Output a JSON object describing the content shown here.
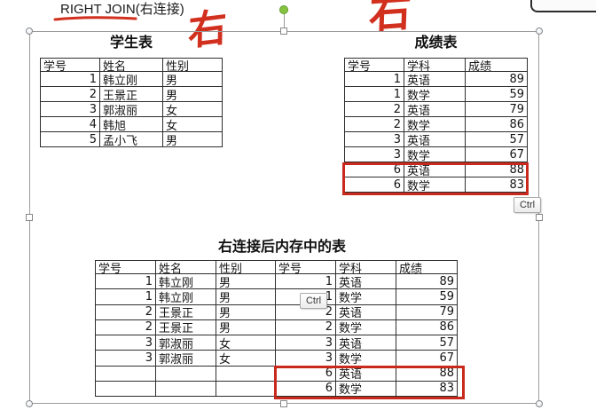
{
  "slide": {
    "heading": "RIGHT JOIN(右连接)"
  },
  "ink_annotations": [
    {
      "text": "右"
    },
    {
      "text": "右"
    }
  ],
  "student_table": {
    "title": "学生表",
    "columns": [
      "学号",
      "姓名",
      "性别"
    ],
    "rows": [
      [
        "1",
        "韩立刚",
        "男"
      ],
      [
        "2",
        "王景正",
        "男"
      ],
      [
        "3",
        "郭淑丽",
        "女"
      ],
      [
        "4",
        "韩旭",
        "女"
      ],
      [
        "5",
        "孟小飞",
        "男"
      ]
    ]
  },
  "score_table": {
    "title": "成绩表",
    "columns": [
      "学号",
      "学科",
      "成绩"
    ],
    "rows": [
      [
        "1",
        "英语",
        "89"
      ],
      [
        "1",
        "数学",
        "59"
      ],
      [
        "2",
        "英语",
        "79"
      ],
      [
        "2",
        "数学",
        "86"
      ],
      [
        "3",
        "英语",
        "57"
      ],
      [
        "3",
        "数学",
        "67"
      ],
      [
        "6",
        "英语",
        "88"
      ],
      [
        "6",
        "数学",
        "83"
      ]
    ]
  },
  "joined_table": {
    "title": "右连接后内存中的表",
    "columns": [
      "学号",
      "姓名",
      "性别",
      "学号",
      "学科",
      "成绩"
    ],
    "rows": [
      [
        "1",
        "韩立刚",
        "男",
        "1",
        "英语",
        "89"
      ],
      [
        "1",
        "韩立刚",
        "男",
        "1",
        "数学",
        "59"
      ],
      [
        "2",
        "王景正",
        "男",
        "2",
        "英语",
        "79"
      ],
      [
        "2",
        "王景正",
        "男",
        "2",
        "数学",
        "86"
      ],
      [
        "3",
        "郭淑丽",
        "女",
        "3",
        "英语",
        "57"
      ],
      [
        "3",
        "郭淑丽",
        "女",
        "3",
        "数学",
        "67"
      ],
      [
        "",
        "",
        "",
        "6",
        "英语",
        "88"
      ],
      [
        "",
        "",
        "",
        "6",
        "数学",
        "83"
      ]
    ]
  },
  "paste_option_badges": [
    {
      "label": "Ctrl"
    },
    {
      "label": "Ctrl"
    }
  ],
  "colors": {
    "ink_red": "#d2301f",
    "highlight_red": "#c8291c",
    "selection_border": "#9c9c9c",
    "rotate_handle_green": "#86c440",
    "table_border": "#2e2e2e"
  }
}
